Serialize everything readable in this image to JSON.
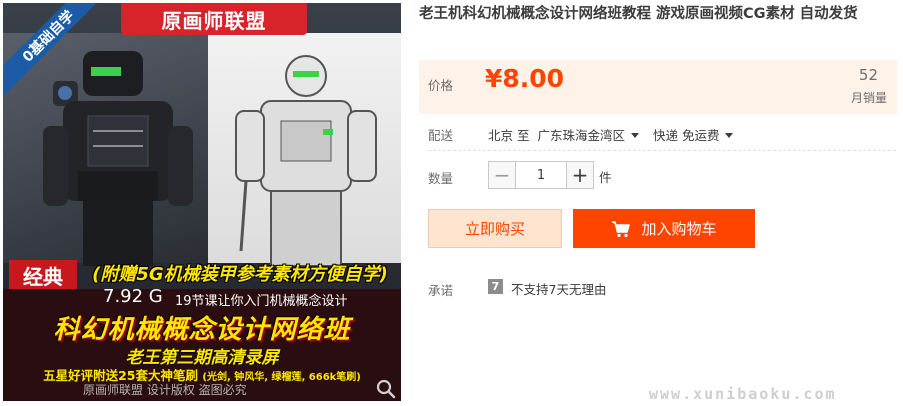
{
  "image": {
    "banner_title": "原画师联盟",
    "corner_ribbon": "0基础自学",
    "badge": "经典",
    "gift_text": "(附赠5G机械装甲参考素材方便自学)",
    "size": "7.92 G",
    "lessons": "19节课让你入门机械概念设计",
    "course_title": "科幻机械概念设计网络班",
    "period": "老王第三期高清录屏",
    "brush_offer": "五星好评附送25套大神笔刷",
    "brush_note": "(光剑, 钟风华, 绿榴莲, 666k笔刷)",
    "footer": "原画师联盟   设计版权  盗图必究"
  },
  "product": {
    "title": "老王机科幻机械概念设计网络班教程 游戏原画视频CG素材 自动发货"
  },
  "price": {
    "label": "价格",
    "value": "¥8.00",
    "sales_count": "52",
    "sales_label": "月销量"
  },
  "shipping": {
    "label": "配送",
    "from": "北京 至",
    "to": "广东珠海金湾区",
    "method": "快递 免运费"
  },
  "quantity": {
    "label": "数量",
    "value": "1",
    "minus": "−",
    "plus": "+",
    "unit": "件"
  },
  "actions": {
    "buy_now": "立即购买",
    "add_to_cart": "加入购物车"
  },
  "promise": {
    "label": "承诺",
    "icon_text": "7",
    "text": "不支持7天无理由"
  },
  "watermark": "www.xunibaoku.com",
  "colors": {
    "accent": "#ff4400",
    "price_bg": "#fff2e8",
    "buy_now_bg": "#ffe4d0",
    "banner_red": "#d8232a",
    "ribbon_blue": "#1a5ca8",
    "title_yellow": "#ffe600"
  }
}
